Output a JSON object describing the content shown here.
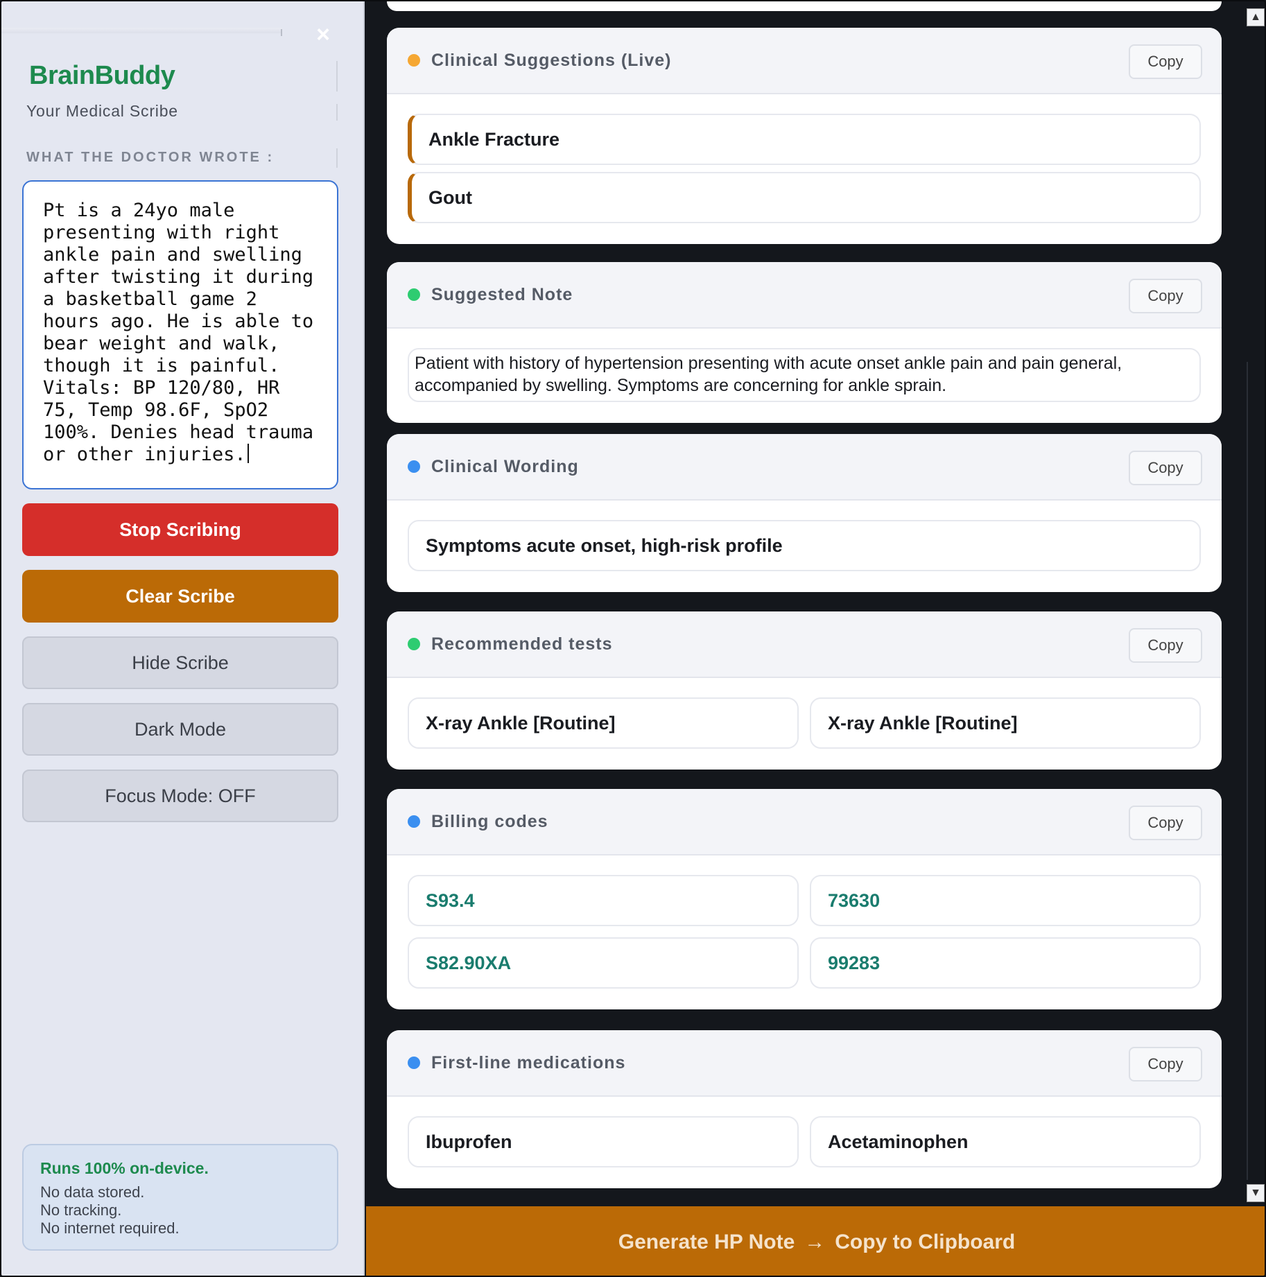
{
  "sidebar": {
    "brand": "BrainBuddy",
    "tagline": "Your Medical Scribe",
    "section_label": "WHAT THE DOCTOR WROTE :",
    "notes_value": "Pt is a 24yo male presenting with right ankle pain and swelling after twisting it during a basketball game 2 hours ago. He is able to bear weight and walk, though it is painful. Vitals: BP 120/80, HR 75, Temp 98.6F, SpO2 100%. Denies head trauma or other injuries.",
    "close_glyph": "×",
    "buttons": {
      "stop": "Stop Scribing",
      "clear": "Clear Scribe",
      "hide": "Hide Scribe",
      "dark": "Dark Mode",
      "focus": "Focus Mode: OFF"
    },
    "privacy": {
      "title": "Runs 100% on-device.",
      "lines": [
        "No data stored.",
        "No tracking.",
        "No internet required."
      ]
    }
  },
  "copy_label": "Copy",
  "cards": {
    "suggestions": {
      "title": "Clinical Suggestions (Live)",
      "dot_color": "#f5a733",
      "items": [
        "Ankle Fracture",
        "Gout"
      ]
    },
    "note": {
      "title": "Suggested Note",
      "dot_color": "#2ecc71",
      "text": "Patient with history of hypertension presenting with acute onset ankle pain and pain general, accompanied by swelling. Symptoms are concerning for ankle sprain."
    },
    "wording": {
      "title": "Clinical Wording",
      "dot_color": "#3b8ff0",
      "items": [
        "Symptoms acute onset, high-risk profile"
      ]
    },
    "tests": {
      "title": "Recommended tests",
      "dot_color": "#2ecc71",
      "items": [
        "X-ray Ankle [Routine]",
        "X-ray Ankle [Routine]"
      ]
    },
    "billing": {
      "title": "Billing codes",
      "dot_color": "#3b8ff0",
      "items": [
        "S93.4",
        "73630",
        "S82.90XA",
        "99283"
      ]
    },
    "meds": {
      "title": "First-line medications",
      "dot_color": "#3b8ff0",
      "items": [
        "Ibuprofen",
        "Acetaminophen"
      ]
    }
  },
  "generate": {
    "left": "Generate HP Note",
    "arrow": "→",
    "right": "Copy to Clipboard"
  },
  "scroll": {
    "up": "▲",
    "down": "▼"
  },
  "colors": {
    "accent": "#bb6a06",
    "danger": "#d52e2a",
    "brand": "#1d8a4e",
    "code": "#1a7c6e"
  }
}
